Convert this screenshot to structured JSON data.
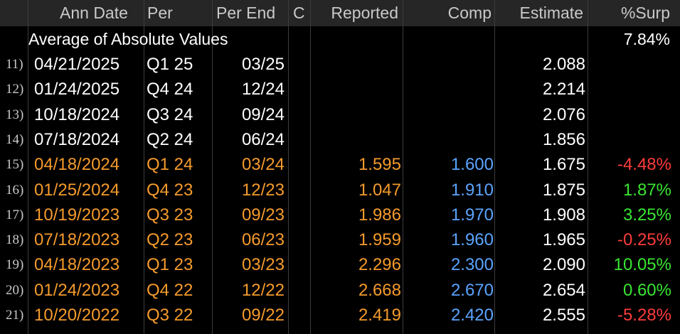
{
  "header": {
    "ann_date": "Ann Date",
    "per": "Per",
    "per_end": "Per End",
    "c": "C",
    "reported": "Reported",
    "comp": "Comp",
    "estimate": "Estimate",
    "surp": "%Surp"
  },
  "summary": {
    "label": "Average of Absolute Values",
    "value": "7.84%"
  },
  "rows": [
    {
      "num": "11)",
      "date": "04/21/2025",
      "per": "Q1 25",
      "per_end": "03/25",
      "reported": "",
      "comp": "",
      "estimate": "2.088",
      "surp": "",
      "surp_sign": ""
    },
    {
      "num": "12)",
      "date": "01/24/2025",
      "per": "Q4 24",
      "per_end": "12/24",
      "reported": "",
      "comp": "",
      "estimate": "2.214",
      "surp": "",
      "surp_sign": ""
    },
    {
      "num": "13)",
      "date": "10/18/2024",
      "per": "Q3 24",
      "per_end": "09/24",
      "reported": "",
      "comp": "",
      "estimate": "2.076",
      "surp": "",
      "surp_sign": ""
    },
    {
      "num": "14)",
      "date": "07/18/2024",
      "per": "Q2 24",
      "per_end": "06/24",
      "reported": "",
      "comp": "",
      "estimate": "1.856",
      "surp": "",
      "surp_sign": ""
    },
    {
      "num": "15)",
      "date": "04/18/2024",
      "per": "Q1 24",
      "per_end": "03/24",
      "reported": "1.595",
      "comp": "1.600",
      "estimate": "1.675",
      "surp": "-4.48%",
      "surp_sign": "neg"
    },
    {
      "num": "16)",
      "date": "01/25/2024",
      "per": "Q4 23",
      "per_end": "12/23",
      "reported": "1.047",
      "comp": "1.910",
      "estimate": "1.875",
      "surp": "1.87%",
      "surp_sign": "pos"
    },
    {
      "num": "17)",
      "date": "10/19/2023",
      "per": "Q3 23",
      "per_end": "09/23",
      "reported": "1.986",
      "comp": "1.970",
      "estimate": "1.908",
      "surp": "3.25%",
      "surp_sign": "pos"
    },
    {
      "num": "18)",
      "date": "07/18/2023",
      "per": "Q2 23",
      "per_end": "06/23",
      "reported": "1.959",
      "comp": "1.960",
      "estimate": "1.965",
      "surp": "-0.25%",
      "surp_sign": "neg"
    },
    {
      "num": "19)",
      "date": "04/18/2023",
      "per": "Q1 23",
      "per_end": "03/23",
      "reported": "2.296",
      "comp": "2.300",
      "estimate": "2.090",
      "surp": "10.05%",
      "surp_sign": "pos"
    },
    {
      "num": "20)",
      "date": "01/24/2023",
      "per": "Q4 22",
      "per_end": "12/22",
      "reported": "2.668",
      "comp": "2.670",
      "estimate": "2.654",
      "surp": "0.60%",
      "surp_sign": "pos"
    },
    {
      "num": "21)",
      "date": "10/20/2022",
      "per": "Q3 22",
      "per_end": "09/22",
      "reported": "2.419",
      "comp": "2.420",
      "estimate": "2.555",
      "surp": "-5.28%",
      "surp_sign": "neg"
    }
  ],
  "colors": {
    "header_bg": "#262626",
    "future_text": "#ffffff",
    "reported_text": "#f59b2c",
    "comp_text": "#5aa4ff",
    "negative": "#ff3b3b",
    "positive": "#39e632"
  }
}
